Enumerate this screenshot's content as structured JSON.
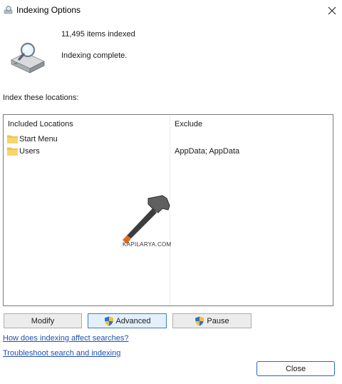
{
  "window": {
    "title": "Indexing Options"
  },
  "status": {
    "count_text": "11,495 items indexed",
    "status_text": "Indexing complete."
  },
  "section": {
    "label": "Index these locations:"
  },
  "table": {
    "headers": {
      "included": "Included Locations",
      "exclude": "Exclude"
    },
    "rows": [
      {
        "location": "Start Menu",
        "exclude": ""
      },
      {
        "location": "Users",
        "exclude": "AppData; AppData"
      }
    ]
  },
  "watermark": {
    "text": "KAPILARYA.COM"
  },
  "buttons": {
    "modify": "Modify",
    "advanced": "Advanced",
    "pause": "Pause",
    "close": "Close"
  },
  "links": {
    "how_affects": "How does indexing affect searches?",
    "troubleshoot": "Troubleshoot search and indexing"
  },
  "colors": {
    "link": "#1f4fb5",
    "accent_border": "#2a66c2",
    "folder": "#f3c64b"
  }
}
